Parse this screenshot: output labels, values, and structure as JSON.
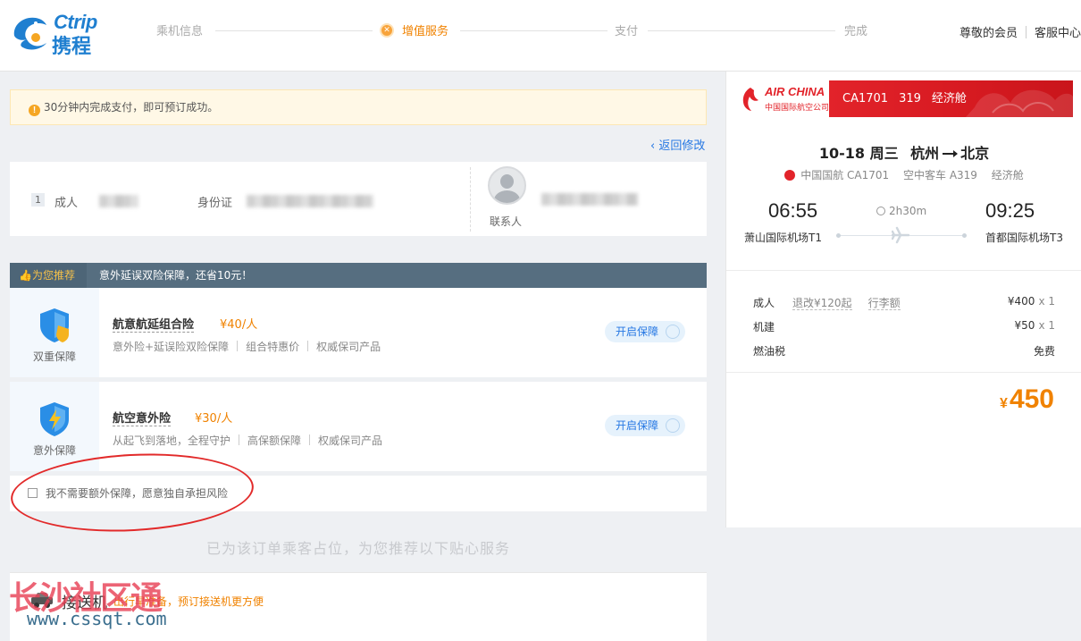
{
  "header": {
    "logo_en": "Ctrip",
    "logo_cn": "携程",
    "steps": [
      "乘机信息",
      "增值服务",
      "支付",
      "完成"
    ],
    "active_step": 1,
    "member": "尊敬的会员",
    "service": "客服中心"
  },
  "notice": {
    "icon": "!",
    "text": "30分钟内完成支付，即可预订成功。"
  },
  "back_link": "返回修改",
  "passenger": {
    "index": "1",
    "type": "成人",
    "id_type": "身份证",
    "contact_label": "联系人"
  },
  "recommend": {
    "tag": "为您推荐",
    "text": "意外延误双险保障，还省10元！"
  },
  "insurances": [
    {
      "left_label": "双重保障",
      "name": "航意航延组合险",
      "price": "¥40/人",
      "features": [
        "意外险+延误险双险保障",
        "组合特惠价",
        "权威保司产品"
      ],
      "button": "开启保障"
    },
    {
      "left_label": "意外保障",
      "name": "航空意外险",
      "price": "¥30/人",
      "features": [
        "从起飞到落地，全程守护",
        "高保额保障",
        "权威保司产品"
      ],
      "button": "开启保障"
    }
  ],
  "decline_text": "我不需要额外保障，愿意独自承担风险",
  "services_tip": "已为该订单乘客占位，为您推荐以下贴心服务",
  "transfer": {
    "title": "接送机",
    "tip": "出行早准备，预订接送机更方便"
  },
  "watermark": {
    "text": "长沙社区通",
    "url": "www.cssqt.com"
  },
  "flight": {
    "airline_logo_text": "AIR CHINA",
    "airline_logo_cn": "中国国际航空公司",
    "flight_no": "CA1701",
    "plane_code": "319",
    "cabin": "经济舱",
    "date": "10-18",
    "weekday": "周三",
    "from_city": "杭州",
    "to_city": "北京",
    "airline_line": "中国国航 CA1701",
    "aircraft": "空中客车 A319",
    "cabin_line": "经济舱",
    "dep_time": "06:55",
    "arr_time": "09:25",
    "duration": "2h30m",
    "dep_airport": "萧山国际机场T1",
    "arr_airport": "首都国际机场T3"
  },
  "fees": [
    {
      "label": "成人",
      "links": [
        "退改¥120起",
        "行李额"
      ],
      "amount": "¥400",
      "qty": "x 1"
    },
    {
      "label": "机建",
      "links": [],
      "amount": "¥50",
      "qty": "x 1"
    },
    {
      "label": "燃油税",
      "links": [],
      "amount": "免费",
      "qty": ""
    }
  ],
  "total": {
    "currency": "¥",
    "amount": "450"
  },
  "colors": {
    "brand_blue": "#1f7fd0",
    "accent_orange": "#f08200",
    "air_china_red": "#e2232a",
    "link_blue": "#2577e3"
  }
}
